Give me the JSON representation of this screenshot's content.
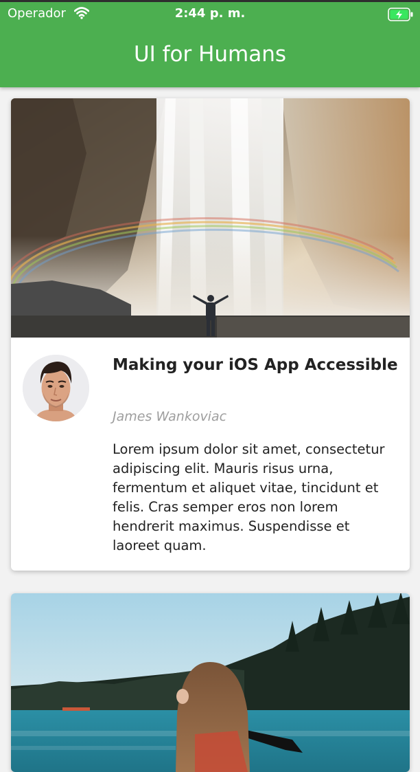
{
  "status_bar": {
    "carrier": "Operador",
    "time": "2:44 p. m.",
    "icons": [
      "wifi-icon",
      "battery-charging-icon"
    ]
  },
  "app_bar": {
    "title": "UI for Humans"
  },
  "colors": {
    "app_bar": "#4caf50",
    "background": "#f2f2f2",
    "card": "#ffffff",
    "author": "#9e9e9e"
  },
  "cards": [
    {
      "image": "waterfall-rainbow-photo",
      "avatar": "author-avatar-photo",
      "title": "Making your iOS App Accessible",
      "author": "James Wankoviac",
      "body": "Lorem ipsum dolor sit amet, consectetur adipiscing elit. Mauris risus urna, fermentum et aliquet vitae, tincidunt et felis. Cras semper eros non lorem hendrerit maximus. Suspendisse et laoreet quam."
    },
    {
      "image": "lake-kayak-photo"
    }
  ]
}
